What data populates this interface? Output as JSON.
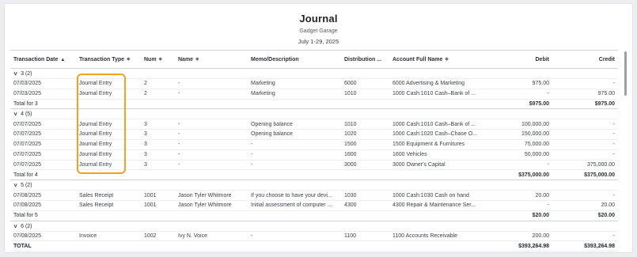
{
  "report": {
    "title": "Journal",
    "company": "Gadget Garage",
    "period": "July 1-29, 2025"
  },
  "columns": {
    "date": "Transaction Date",
    "type": "Transaction Type",
    "num": "Num",
    "name": "Name",
    "memo": "Memo/Description",
    "distribution": "Distribution ...",
    "account": "Account Full Name",
    "debit": "Debit",
    "credit": "Credit"
  },
  "icons": {
    "sort_active": "▲",
    "sort_both": "◆",
    "chevron": "∨"
  },
  "groups": [
    {
      "label": "3 (2)",
      "rows": [
        {
          "date": "07/03/2025",
          "type": "Journal Entry",
          "num": "2",
          "name": "-",
          "memo": "Marketing",
          "dist": "6000",
          "account": "6000 Advertising & Marketing",
          "debit": "975.00",
          "credit": "-"
        },
        {
          "date": "07/03/2025",
          "type": "Journal Entry",
          "num": "2",
          "name": "-",
          "memo": "Marketing",
          "dist": "1010",
          "account": "1000 Cash:1010 Cash–Bank of ...",
          "debit": "-",
          "credit": "975.00"
        }
      ],
      "total_label": "Total for 3",
      "total_debit": "$975.00",
      "total_credit": "$975.00"
    },
    {
      "label": "4 (5)",
      "rows": [
        {
          "date": "07/07/2025",
          "type": "Journal Entry",
          "num": "3",
          "name": "-",
          "memo": "Opening balance",
          "dist": "1010",
          "account": "1000 Cash:1010 Cash–Bank of ...",
          "debit": "100,000.00",
          "credit": "-"
        },
        {
          "date": "07/07/2025",
          "type": "Journal Entry",
          "num": "3",
          "name": "-",
          "memo": "Opening balance",
          "dist": "1020",
          "account": "1000 Cash:1020 Cash–Chase O...",
          "debit": "150,000.00",
          "credit": "-"
        },
        {
          "date": "07/07/2025",
          "type": "Journal Entry",
          "num": "3",
          "name": "-",
          "memo": "-",
          "dist": "1500",
          "account": "1500 Equipment & Furnitures",
          "debit": "75,000.00",
          "credit": "-"
        },
        {
          "date": "07/07/2025",
          "type": "Journal Entry",
          "num": "3",
          "name": "-",
          "memo": "-",
          "dist": "1600",
          "account": "1600 Vehicles",
          "debit": "50,000.00",
          "credit": "-"
        },
        {
          "date": "07/07/2025",
          "type": "Journal Entry",
          "num": "3",
          "name": "-",
          "memo": "-",
          "dist": "3000",
          "account": "3000 Owner's Capital",
          "debit": "-",
          "credit": "375,000.00"
        }
      ],
      "total_label": "Total for 4",
      "total_debit": "$375,000.00",
      "total_credit": "$375,000.00"
    },
    {
      "label": "5 (2)",
      "rows": [
        {
          "date": "07/08/2025",
          "type": "Sales Receipt",
          "num": "1001",
          "name": "Jason Tyler Whitmore",
          "memo": "If you choose to have your devi...",
          "dist": "1030",
          "account": "1000 Cash:1030 Cash on hand",
          "debit": "20.00",
          "credit": "-"
        },
        {
          "date": "07/08/2025",
          "type": "Sales Receipt",
          "num": "1001",
          "name": "Jason Tyler Whitmore",
          "memo": "Initial assessment of computer ...",
          "dist": "4300",
          "account": "4300 Repair & Maintenance Ser...",
          "debit": "-",
          "credit": "20.00"
        }
      ],
      "total_label": "Total for 5",
      "total_debit": "$20.00",
      "total_credit": "$20.00"
    },
    {
      "label": "6 (2)",
      "rows": [
        {
          "date": "07/08/2025",
          "type": "Invoice",
          "num": "1002",
          "name": "Ivy N. Voice",
          "memo": "-",
          "dist": "1100",
          "account": "1100 Accounts Receivable",
          "debit": "200.00",
          "credit": "-"
        }
      ]
    }
  ],
  "grand_total": {
    "label": "TOTAL",
    "debit": "$393,264.98",
    "credit": "$393,264.98"
  },
  "colors": {
    "highlight": "#f4a024",
    "scrollbar": "#9aa0a6"
  }
}
